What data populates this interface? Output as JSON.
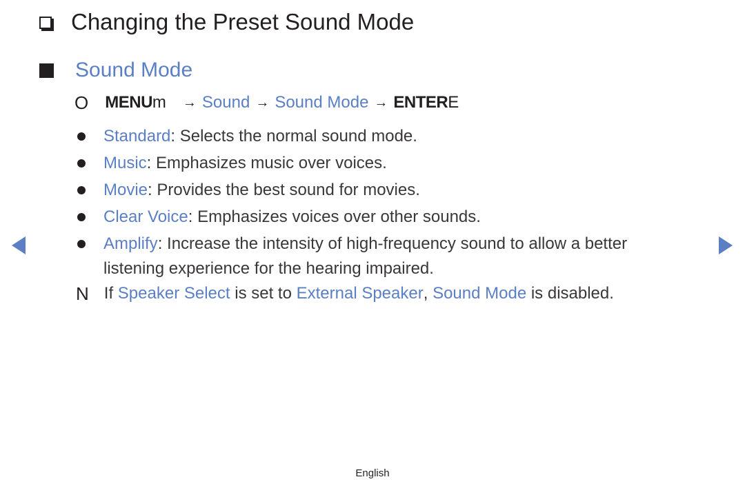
{
  "heading": {
    "icon": "checkbox-icon",
    "title": "Changing the Preset Sound Mode"
  },
  "section": {
    "icon": "square-bullet-icon",
    "title": "Sound Mode"
  },
  "menu_path": {
    "prefix_glyph": "O",
    "menu_label": "MENU",
    "menu_suffix": "m",
    "arrow": "→",
    "steps": [
      "Sound",
      "Sound Mode"
    ],
    "enter_label": "ENTER",
    "enter_suffix": "E"
  },
  "options": [
    {
      "name": "Standard",
      "description": ": Selects the normal sound mode."
    },
    {
      "name": "Music",
      "description": ": Emphasizes music over voices."
    },
    {
      "name": "Movie",
      "description": ": Provides the best sound for movies."
    },
    {
      "name": "Clear Voice",
      "description": ": Emphasizes voices over other sounds."
    },
    {
      "name": "Amplify",
      "description": ": Increase the intensity of high-frequency sound to allow a better",
      "continuation": "listening experience for the hearing impaired."
    }
  ],
  "note": {
    "glyph": "N",
    "text_1": "If ",
    "link_1": "Speaker Select",
    "text_2": " is set to ",
    "link_2": "External Speaker",
    "text_3": ", ",
    "link_3": "Sound Mode",
    "text_4": " is disabled."
  },
  "navigation": {
    "prev_icon": "triangle-left-icon",
    "next_icon": "triangle-right-icon"
  },
  "footer": {
    "language": "English"
  },
  "colors": {
    "accent": "#5b7fc4",
    "text": "#231f20"
  }
}
